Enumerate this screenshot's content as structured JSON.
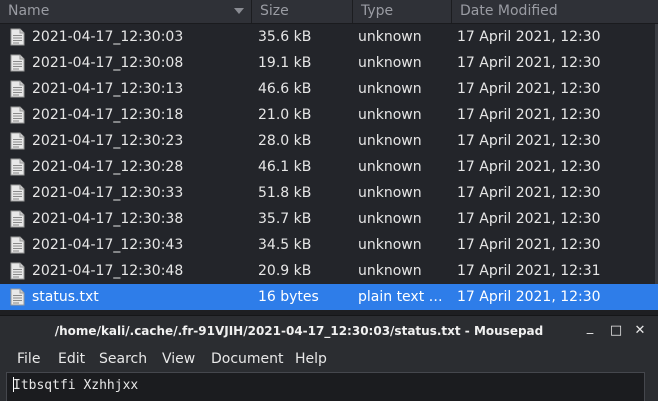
{
  "file_list": {
    "columns": {
      "name": "Name",
      "size": "Size",
      "type": "Type",
      "date": "Date Modified"
    },
    "files": [
      {
        "name": "2021-04-17_12:30:03",
        "size": "35.6 kB",
        "type": "unknown",
        "date": "17 April 2021, 12:30",
        "selected": false
      },
      {
        "name": "2021-04-17_12:30:08",
        "size": "19.1 kB",
        "type": "unknown",
        "date": "17 April 2021, 12:30",
        "selected": false
      },
      {
        "name": "2021-04-17_12:30:13",
        "size": "46.6 kB",
        "type": "unknown",
        "date": "17 April 2021, 12:30",
        "selected": false
      },
      {
        "name": "2021-04-17_12:30:18",
        "size": "21.0 kB",
        "type": "unknown",
        "date": "17 April 2021, 12:30",
        "selected": false
      },
      {
        "name": "2021-04-17_12:30:23",
        "size": "28.0 kB",
        "type": "unknown",
        "date": "17 April 2021, 12:30",
        "selected": false
      },
      {
        "name": "2021-04-17_12:30:28",
        "size": "46.1 kB",
        "type": "unknown",
        "date": "17 April 2021, 12:30",
        "selected": false
      },
      {
        "name": "2021-04-17_12:30:33",
        "size": "51.8 kB",
        "type": "unknown",
        "date": "17 April 2021, 12:30",
        "selected": false
      },
      {
        "name": "2021-04-17_12:30:38",
        "size": "35.7 kB",
        "type": "unknown",
        "date": "17 April 2021, 12:30",
        "selected": false
      },
      {
        "name": "2021-04-17_12:30:43",
        "size": "34.5 kB",
        "type": "unknown",
        "date": "17 April 2021, 12:30",
        "selected": false
      },
      {
        "name": "2021-04-17_12:30:48",
        "size": "20.9 kB",
        "type": "unknown",
        "date": "17 April 2021, 12:31",
        "selected": false
      },
      {
        "name": "status.txt",
        "size": "16 bytes",
        "type": "plain text document",
        "date": "17 April 2021, 12:30",
        "selected": true
      }
    ]
  },
  "mousepad": {
    "title": "/home/kali/.cache/.fr-91VJIH/2021-04-17_12:30:03/status.txt - Mousepad",
    "window_buttons": {
      "minimize": "_",
      "maximize": "□",
      "close": "✕"
    },
    "menu": [
      "File",
      "Edit",
      "Search",
      "View",
      "Document",
      "Help"
    ],
    "content": "Itbsqtfi Xzhhjxx"
  },
  "colors": {
    "selection": "#2e7de9",
    "background": "#23252a"
  },
  "icons": {
    "file": "text-file-icon",
    "sort": "sort-descending-icon"
  }
}
